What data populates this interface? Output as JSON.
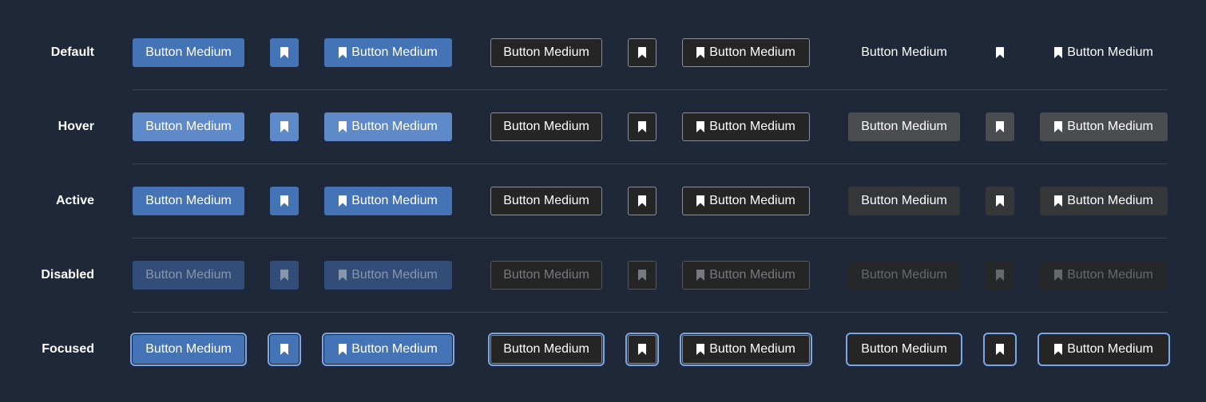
{
  "labels": {
    "button_text": "Button Medium"
  },
  "icons": {
    "bookmark": "bookmark-icon"
  },
  "colors": {
    "background": "#1f2838",
    "primary": "#4574b6",
    "primary_hover": "#5f8ac9",
    "primary_disabled": "#324e78",
    "secondary_border": "#8b8f96",
    "tertiary_hover": "#4b4c4f",
    "tertiary_active": "#353638",
    "focus_ring": "#7aa6e6"
  },
  "rows": [
    {
      "key": "default",
      "label": "Default"
    },
    {
      "key": "hover",
      "label": "Hover"
    },
    {
      "key": "active",
      "label": "Active"
    },
    {
      "key": "disabled",
      "label": "Disabled"
    },
    {
      "key": "focused",
      "label": "Focused"
    }
  ]
}
